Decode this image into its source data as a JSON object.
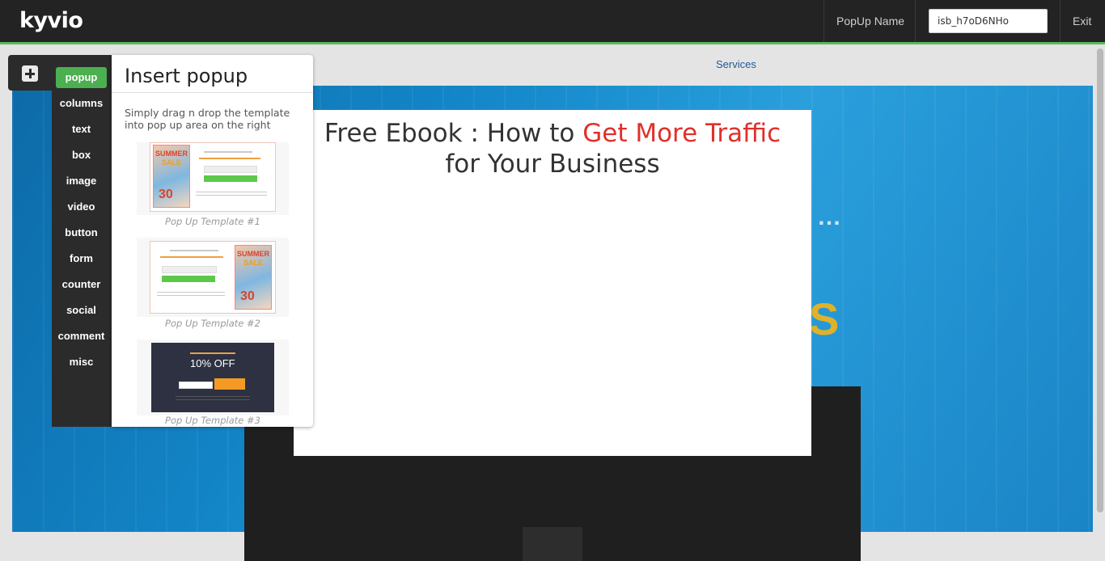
{
  "topbar": {
    "logo": "kyvio",
    "popup_name_label": "PopUp Name",
    "popup_name_value": "isb_h7oD6NHo",
    "exit_label": "Exit",
    "accent_color": "#5cb85c"
  },
  "background_page": {
    "nav_link": "Services"
  },
  "popup_canvas": {
    "title_part1": "Free Ebook : How to ",
    "title_highlight": "Get More Traffic",
    "title_part2": "for Your Business",
    "highlight_color": "#e0302a"
  },
  "tool_menu": {
    "add_icon": "plus-icon",
    "items": [
      {
        "label": "popup",
        "active": true
      },
      {
        "label": "columns",
        "active": false
      },
      {
        "label": "text",
        "active": false
      },
      {
        "label": "box",
        "active": false
      },
      {
        "label": "image",
        "active": false
      },
      {
        "label": "video",
        "active": false
      },
      {
        "label": "button",
        "active": false
      },
      {
        "label": "form",
        "active": false
      },
      {
        "label": "counter",
        "active": false
      },
      {
        "label": "social",
        "active": false
      },
      {
        "label": "comment",
        "active": false
      },
      {
        "label": "misc",
        "active": false
      }
    ]
  },
  "insert_panel": {
    "title": "Insert popup",
    "description": "Simply drag n drop the template into pop up area on the right",
    "templates": [
      {
        "caption": "Pop Up Template #1",
        "sale_word1": "SUMMER",
        "sale_word2": "SALE",
        "sale_number": "30"
      },
      {
        "caption": "Pop Up Template #2",
        "sale_word1": "SUMMER",
        "sale_word2": "SALE",
        "sale_number": "30"
      },
      {
        "caption": "Pop Up Template #3",
        "offer": "10% OFF"
      }
    ]
  }
}
